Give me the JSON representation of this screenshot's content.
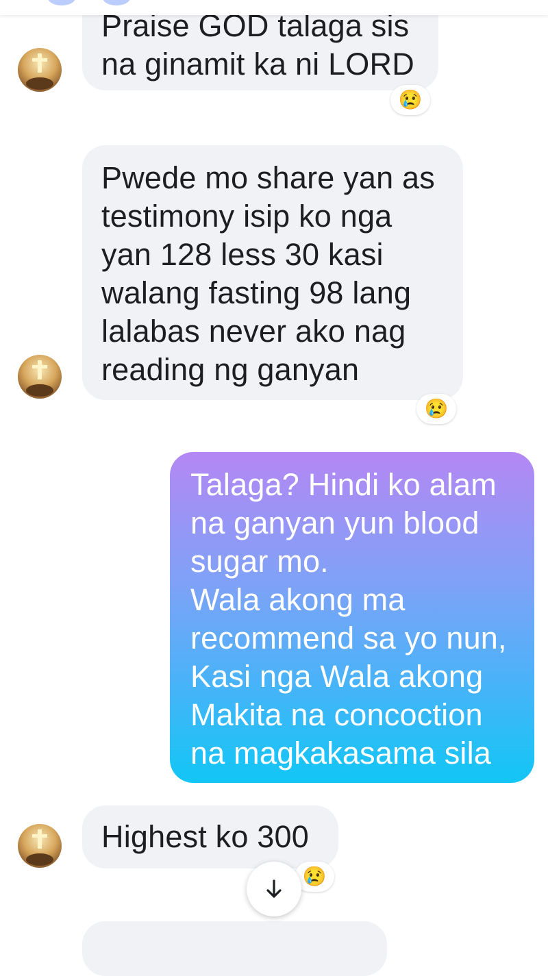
{
  "conversation": {
    "messages": [
      {
        "direction": "incoming",
        "text": "Praise GOD talaga sis\nna ginamit ka ni LORD",
        "reaction": "😢"
      },
      {
        "direction": "incoming",
        "text": "Pwede mo share yan as\ntestimony isip ko nga\nyan 128 less 30 kasi\nwalang fasting 98 lang\nlalabas never ako nag\nreading ng ganyan",
        "reaction": "😢"
      },
      {
        "direction": "outgoing",
        "text": "Talaga? Hindi ko alam\nna ganyan yun blood\nsugar mo.\nWala akong ma\nrecommend sa yo nun,\nKasi nga Wala akong\nMakita na concoction\nna magkakasama sila"
      },
      {
        "direction": "incoming",
        "text": "Highest ko 300",
        "reaction": "😢"
      }
    ]
  },
  "scroll_down_icon": "arrow-down-icon",
  "avatar_icon": "cross-sunset-avatar",
  "colors": {
    "incoming_bubble": "#f0f2f5",
    "outgoing_gradient_top": "#b487f4",
    "outgoing_gradient_bottom": "#11c6f5",
    "background": "#ffffff"
  }
}
